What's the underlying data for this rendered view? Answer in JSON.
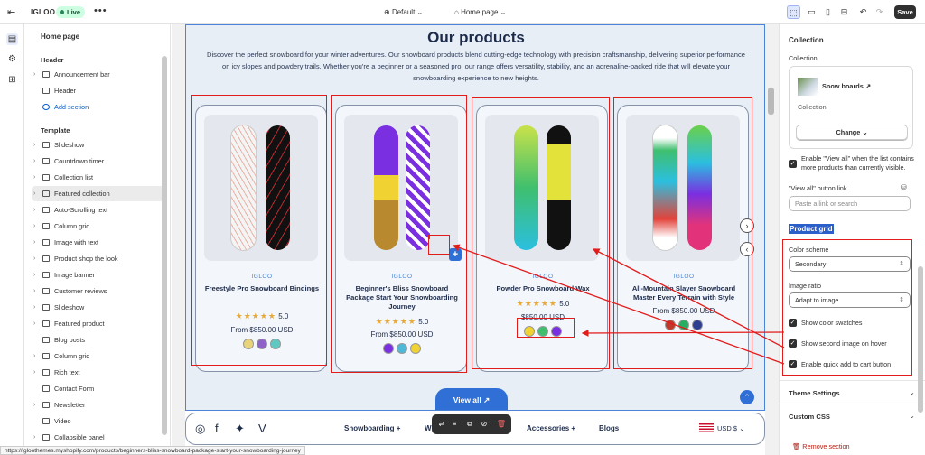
{
  "topbar": {
    "store_name": "IGLOO",
    "status_badge": "Live",
    "more": "•••",
    "theme_label": "Default",
    "page_label": "Home page",
    "save_label": "Save"
  },
  "sidebar": {
    "page_title": "Home page",
    "header_section": "Header",
    "header_items": [
      "Announcement bar",
      "Header"
    ],
    "add_section": "Add section",
    "template_section": "Template",
    "template_items": [
      "Slideshow",
      "Countdown timer",
      "Collection list",
      "Featured collection",
      "Auto-Scrolling text",
      "Column grid",
      "Image with text",
      "Product shop the look",
      "Image banner",
      "Customer reviews",
      "Slideshow",
      "Featured product",
      "Blog posts",
      "Column grid",
      "Rich text",
      "Contact Form",
      "Newsletter",
      "Video",
      "Collapsible panel"
    ],
    "active_item": "Featured collection"
  },
  "preview": {
    "heading": "Our products",
    "description": "Discover the perfect snowboard for your winter adventures. Our snowboard products blend cutting-edge technology with precision craftsmanship, delivering superior performance on icy slopes and powdery trails. Whether you're a beginner or a seasoned pro, our range offers versatility, stability, and an adrenaline-packed ride that will elevate your snowboarding experience to new heights.",
    "products": [
      {
        "vendor": "IGLOO",
        "name": "Freestyle Pro Snowboard Bindings",
        "rating": "5.0",
        "price": "From $850.00 USD",
        "swatches": [
          "#e8d27a",
          "#8e63c9",
          "#5fc9c1"
        ],
        "stars": "★★★★★"
      },
      {
        "vendor": "IGLOO",
        "name": "Beginner's Bliss Snowboard Package Start Your Snowboarding Journey",
        "rating": "5.0",
        "price": "From $850.00 USD",
        "swatches": [
          "#7a2fe0",
          "#4db8d8",
          "#f0d232"
        ],
        "stars": "★★★★★"
      },
      {
        "vendor": "IGLOO",
        "name": "Powder Pro Snowboard Wax",
        "rating": "5.0",
        "price": "$850.00 USD",
        "swatches": [
          "#f0d232",
          "#3fbf6e",
          "#7a2fe0"
        ],
        "stars": "★★★★★"
      },
      {
        "vendor": "IGLOO",
        "name": "All-Mountain Slayer Snowboard Master Every Terrain with Style",
        "rating": "",
        "price": "From $850.00 USD",
        "swatches": [
          "#c0392b",
          "#27ae60",
          "#2c3e8f"
        ],
        "stars": ""
      }
    ],
    "quick_add_icon": "+",
    "view_all": "View all",
    "footer_nav": [
      "Snowboarding +",
      "W",
      "Accessories +",
      "Blogs"
    ],
    "currency": "USD $",
    "status_url": "https://igloothemes.myshopify.com/products/beginners-bliss-snowboard-package-start-your-snowboarding-journey"
  },
  "settings": {
    "section_title": "Collection",
    "collection_label": "Collection",
    "collection_name": "Snow boards",
    "collection_sub": "Collection",
    "change_label": "Change",
    "view_all_checkbox": "Enable \"View all\" when the list contains more products than currently visible.",
    "view_all_link_label": "\"View all\" button link",
    "link_placeholder": "Paste a link or search",
    "product_grid_heading": "Product grid",
    "color_scheme_label": "Color scheme",
    "color_scheme_value": "Secondary",
    "image_ratio_label": "Image ratio",
    "image_ratio_value": "Adapt to image",
    "check_swatches": "Show color swatches",
    "check_second_image": "Show second image on hover",
    "check_quick_add": "Enable quick add to cart button",
    "theme_settings": "Theme Settings",
    "custom_css": "Custom CSS",
    "remove_section": "Remove section"
  },
  "colors": {
    "accent": "#2f6fd6",
    "annotation": "#e21b1b",
    "section_bg": "#e8eef6"
  }
}
